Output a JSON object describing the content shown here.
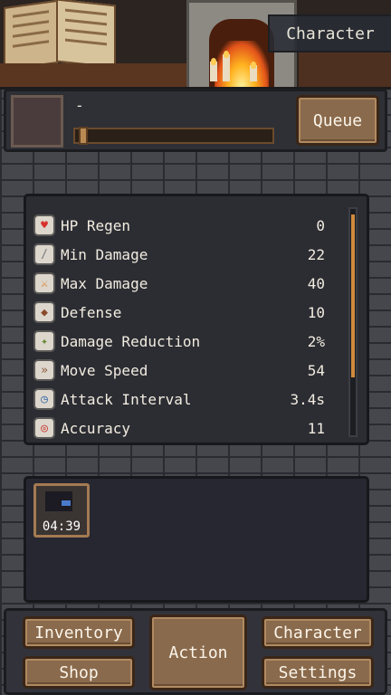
{
  "header": {
    "character_tag": "Character"
  },
  "activity": {
    "name": "-",
    "queue_label": "Queue",
    "progress": 0
  },
  "stats": [
    {
      "label": "HP Regen",
      "value": "0",
      "icon": "heart-plus-icon",
      "color": "#d8302c"
    },
    {
      "label": "Min Damage",
      "value": "22",
      "icon": "dagger-icon",
      "color": "#7a7a80"
    },
    {
      "label": "Max Damage",
      "value": "40",
      "icon": "sword-icon",
      "color": "#e07a20"
    },
    {
      "label": "Defense",
      "value": "10",
      "icon": "shield-icon",
      "color": "#8a4a2a"
    },
    {
      "label": "Damage Reduction",
      "value": "2%",
      "icon": "sparkle-icon",
      "color": "#6a8a3a"
    },
    {
      "label": "Move Speed",
      "value": "54",
      "icon": "winged-boot-icon",
      "color": "#8a5a3a"
    },
    {
      "label": "Attack Interval",
      "value": "3.4s",
      "icon": "clock-sword-icon",
      "color": "#3a6aa8"
    },
    {
      "label": "Accuracy",
      "value": "11",
      "icon": "target-icon",
      "color": "#c8302a"
    }
  ],
  "queue_slots": [
    {
      "timer": "04:39"
    }
  ],
  "nav": {
    "inventory": "Inventory",
    "shop": "Shop",
    "action": "Action",
    "character": "Character",
    "settings": "Settings"
  }
}
